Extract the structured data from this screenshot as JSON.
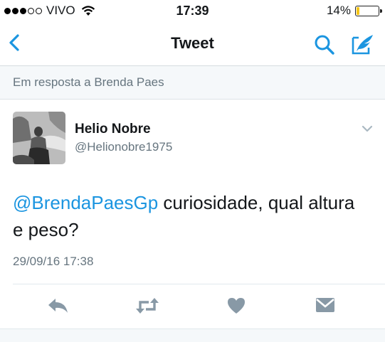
{
  "status_bar": {
    "carrier": "VIVO",
    "time": "17:39",
    "battery_text": "14%",
    "battery_level": 0.14,
    "signal_bars_filled": 3,
    "signal_bars_total": 5
  },
  "nav": {
    "title": "Tweet"
  },
  "reply_banner": {
    "text": "Em resposta a Brenda Paes"
  },
  "tweet": {
    "author_name": "Helio Nobre",
    "author_handle": "@Helionobre1975",
    "mention": "@BrendaPaesGp",
    "body": " curiosidade, qual altura e peso?",
    "timestamp": "29/09/16 17:38"
  },
  "colors": {
    "accent": "#1b95e0",
    "secondary_text": "#66757f",
    "icon_gray": "#8899a6",
    "battery": "#f5c518"
  },
  "icons": [
    "back-icon",
    "search-icon",
    "compose-icon",
    "chevron-down-icon",
    "reply-icon",
    "retweet-icon",
    "like-icon",
    "direct-message-icon"
  ]
}
